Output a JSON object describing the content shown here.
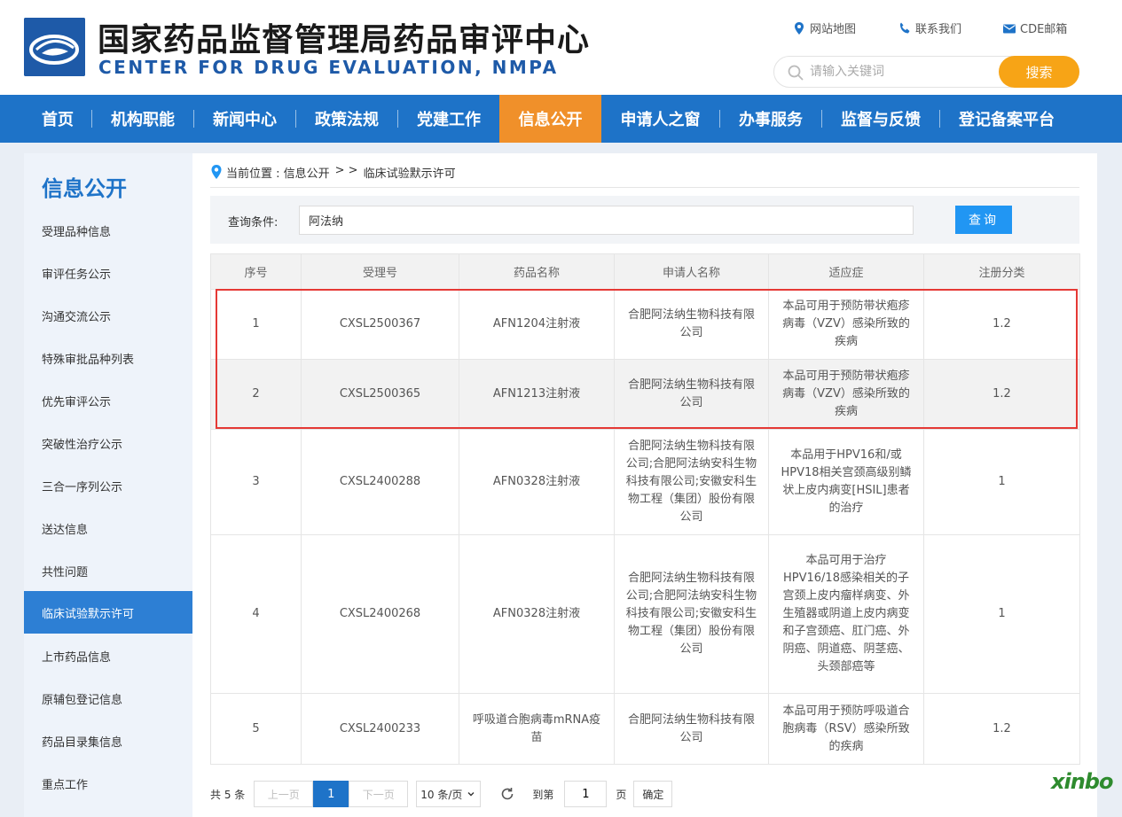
{
  "header": {
    "title": "国家药品监督管理局药品审评中心",
    "subtitle": "CENTER FOR DRUG EVALUATION, NMPA",
    "links": {
      "sitemap": "网站地图",
      "contact": "联系我们",
      "mail": "CDE邮箱"
    },
    "search": {
      "placeholder": "请输入关键词",
      "button": "搜索"
    }
  },
  "nav": {
    "items": [
      "首页",
      "机构职能",
      "新闻中心",
      "政策法规",
      "党建工作",
      "信息公开",
      "申请人之窗",
      "办事服务",
      "监督与反馈",
      "登记备案平台"
    ],
    "active": "信息公开"
  },
  "sidebar": {
    "title": "信息公开",
    "items": [
      "受理品种信息",
      "审评任务公示",
      "沟通交流公示",
      "特殊审批品种列表",
      "优先审评公示",
      "突破性治疗公示",
      "三合一序列公示",
      "送达信息",
      "共性问题",
      "临床试验默示许可",
      "上市药品信息",
      "原辅包登记信息",
      "药品目录集信息",
      "重点工作"
    ],
    "active": "临床试验默示许可"
  },
  "breadcrumb": {
    "prefix": "当前位置 : 信息公开",
    "sep": "> >",
    "current": "临床试验默示许可"
  },
  "query": {
    "label": "查询条件:",
    "value": "阿法纳",
    "button": "查询"
  },
  "table": {
    "headers": [
      "序号",
      "受理号",
      "药品名称",
      "申请人名称",
      "适应症",
      "注册分类"
    ],
    "rows": [
      [
        "1",
        "CXSL2500367",
        "AFN1204注射液",
        "合肥阿法纳生物科技有限公司",
        "本品可用于预防带状疱疹病毒（VZV）感染所致的疾病",
        "1.2"
      ],
      [
        "2",
        "CXSL2500365",
        "AFN1213注射液",
        "合肥阿法纳生物科技有限公司",
        "本品可用于预防带状疱疹病毒（VZV）感染所致的疾病",
        "1.2"
      ],
      [
        "3",
        "CXSL2400288",
        "AFN0328注射液",
        "合肥阿法纳生物科技有限公司;合肥阿法纳安科生物科技有限公司;安徽安科生物工程（集团）股份有限公司",
        "本品用于HPV16和/或HPV18相关宫颈高级别鳞状上皮内病变[HSIL]患者的治疗",
        "1"
      ],
      [
        "4",
        "CXSL2400268",
        "AFN0328注射液",
        "合肥阿法纳生物科技有限公司;合肥阿法纳安科生物科技有限公司;安徽安科生物工程（集团）股份有限公司",
        "本品可用于治疗HPV16/18感染相关的子宫颈上皮内瘤样病变、外生殖器或阴道上皮内病变和子宫颈癌、肛门癌、外阴癌、阴道癌、阴茎癌、头颈部癌等",
        "1"
      ],
      [
        "5",
        "CXSL2400233",
        "呼吸道合胞病毒mRNA疫苗",
        "合肥阿法纳生物科技有限公司",
        "本品可用于预防呼吸道合胞病毒（RSV）感染所致的疾病",
        "1.2"
      ]
    ]
  },
  "pager": {
    "total": "共 5 条",
    "prev": "上一页",
    "page": "1",
    "next": "下一页",
    "size": "10 条/页",
    "goto": "到第",
    "goto_value": "1",
    "page_unit": "页",
    "ok": "确定"
  },
  "watermark": "xinbo"
}
